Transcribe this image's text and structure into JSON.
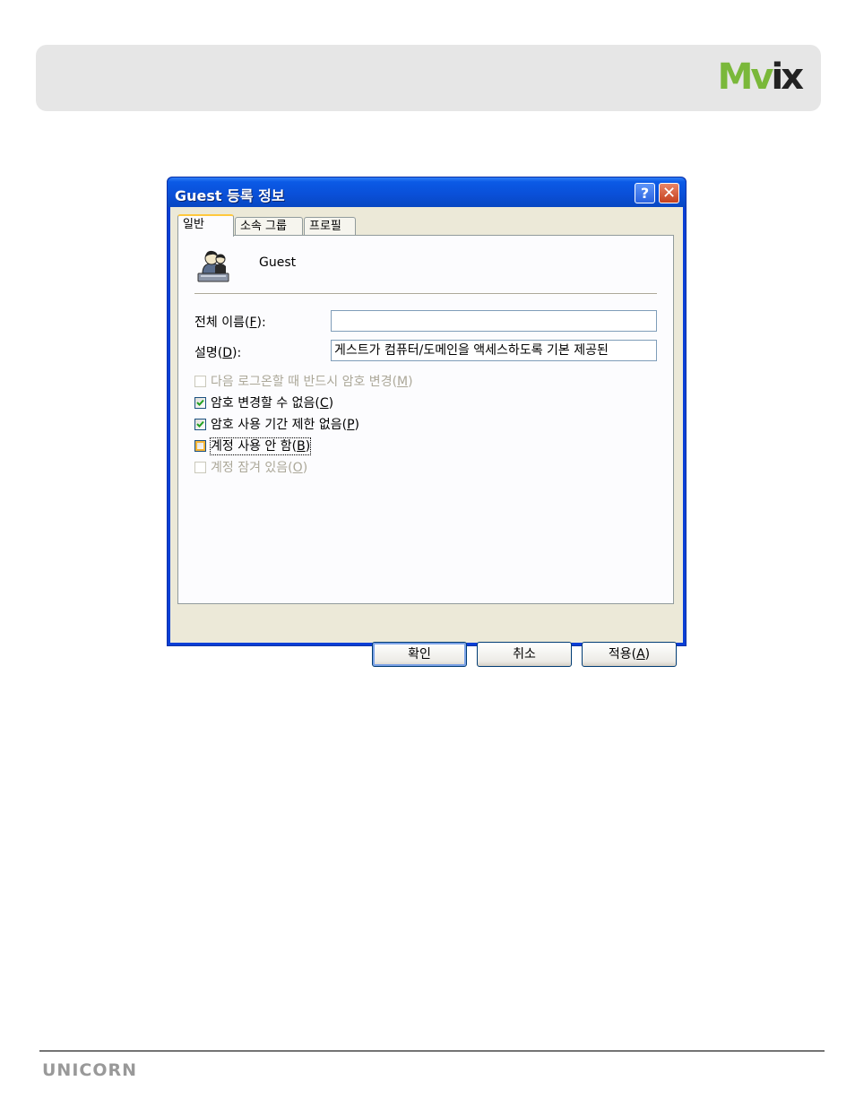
{
  "header": {
    "logo_text_green": "Mv",
    "logo_text_dark": "ix"
  },
  "dialog": {
    "title": "Guest 등록 정보",
    "help_glyph": "?",
    "close_glyph": "✕",
    "tabs": [
      {
        "label": "일반",
        "active": true
      },
      {
        "label": "소속 그룹",
        "active": false
      },
      {
        "label": "프로필",
        "active": false
      }
    ],
    "user_icon": "user-account-icon",
    "user_name": "Guest",
    "full_name": {
      "label_pre": "전체 이름(",
      "accel": "F",
      "label_post": "):",
      "value": ""
    },
    "description": {
      "label_pre": "설명(",
      "accel": "D",
      "label_post": "):",
      "value": "게스트가 컴퓨터/도메인을 액세스하도록 기본 제공된"
    },
    "checkboxes": [
      {
        "pre": "다음 로그온할 때 반드시 암호 변경(",
        "accel": "M",
        "post": ")",
        "checked": false,
        "disabled": true
      },
      {
        "pre": "암호 변경할 수 없음(",
        "accel": "C",
        "post": ")",
        "checked": true,
        "disabled": false
      },
      {
        "pre": "암호 사용 기간 제한 없음(",
        "accel": "P",
        "post": ")",
        "checked": true,
        "disabled": false
      },
      {
        "pre": "계정 사용 안 함(",
        "accel": "B",
        "post": ")",
        "checked": false,
        "disabled": false,
        "focused": true
      },
      {
        "pre": "계정 잠겨 있음(",
        "accel": "O",
        "post": ")",
        "checked": false,
        "disabled": true
      }
    ],
    "buttons": {
      "ok": "확인",
      "cancel": "취소",
      "apply_pre": "적용(",
      "apply_accel": "A",
      "apply_post": ")"
    }
  },
  "footer": {
    "brand": "UNICORN"
  }
}
